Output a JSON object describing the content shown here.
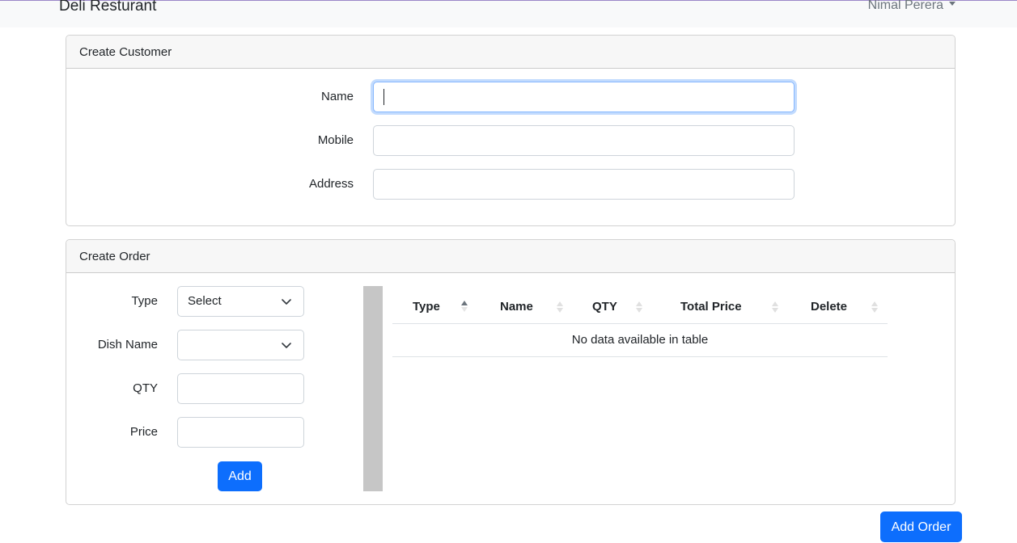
{
  "navbar": {
    "brand": "Deli Resturant",
    "user_name": "Nimal Perera"
  },
  "customer_card": {
    "title": "Create Customer",
    "fields": [
      {
        "label": "Name",
        "value": "",
        "focused": true
      },
      {
        "label": "Mobile",
        "value": ""
      },
      {
        "label": "Address",
        "value": ""
      }
    ]
  },
  "order_card": {
    "title": "Create Order",
    "type_label": "Type",
    "type_selected": "Select",
    "dish_label": "Dish Name",
    "dish_selected": "",
    "qty_label": "QTY",
    "qty_value": "",
    "price_label": "Price",
    "price_value": "",
    "add_button": "Add",
    "table": {
      "columns": [
        {
          "label": "Type",
          "sort": "ascending"
        },
        {
          "label": "Name",
          "sort": "none"
        },
        {
          "label": "QTY",
          "sort": "none"
        },
        {
          "label": "Total Price",
          "sort": "none"
        },
        {
          "label": "Delete",
          "sort": "none"
        }
      ],
      "rows": [],
      "empty_message": "No data available in table"
    }
  },
  "add_order_button": "Add Order",
  "colors": {
    "primary": "#0d6efd",
    "navbar_bg": "#f8f9fa",
    "card_header_bg": "#f7f7f7",
    "focus_ring": "#86b7fe",
    "divider": "#c6c6c6"
  }
}
